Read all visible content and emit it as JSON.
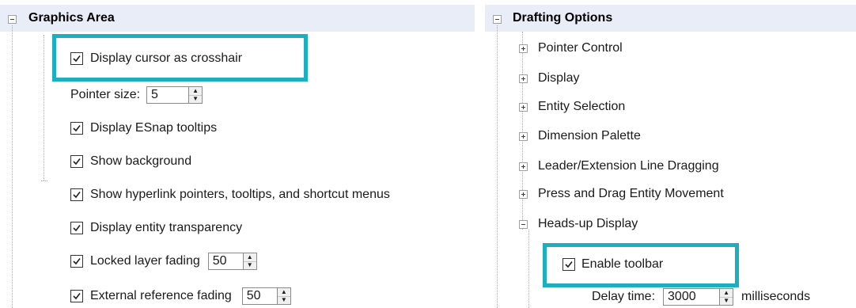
{
  "graphics_area": {
    "title": "Graphics Area",
    "display_cursor_crosshair": {
      "label": "Display cursor as crosshair",
      "checked": true
    },
    "pointer_size": {
      "label": "Pointer size:",
      "value": "5"
    },
    "esnap_tooltips": {
      "label": "Display ESnap tooltips",
      "checked": true
    },
    "show_background": {
      "label": "Show background",
      "checked": true
    },
    "hyperlink_pointers": {
      "label": "Show hyperlink pointers, tooltips, and shortcut menus",
      "checked": true
    },
    "entity_transparency": {
      "label": "Display entity transparency",
      "checked": true
    },
    "locked_layer_fading": {
      "label": "Locked layer fading",
      "checked": true,
      "value": "50"
    },
    "external_reference_fading": {
      "label": "External reference fading",
      "checked": true,
      "value": "50"
    }
  },
  "drafting_options": {
    "title": "Drafting Options",
    "items": [
      {
        "label": "Pointer Control",
        "expanded": false
      },
      {
        "label": "Display",
        "expanded": false
      },
      {
        "label": "Entity Selection",
        "expanded": false
      },
      {
        "label": "Dimension Palette",
        "expanded": false
      },
      {
        "label": "Leader/Extension Line Dragging",
        "expanded": false
      },
      {
        "label": "Press and Drag Entity Movement",
        "expanded": false
      },
      {
        "label": "Heads-up Display",
        "expanded": true
      }
    ],
    "enable_toolbar": {
      "label": "Enable toolbar",
      "checked": true
    },
    "delay_time": {
      "label": "Delay time:",
      "value": "3000",
      "unit": "milliseconds"
    }
  },
  "colors": {
    "highlight": "#1cafc2",
    "header_bg": "#e9edf7"
  }
}
